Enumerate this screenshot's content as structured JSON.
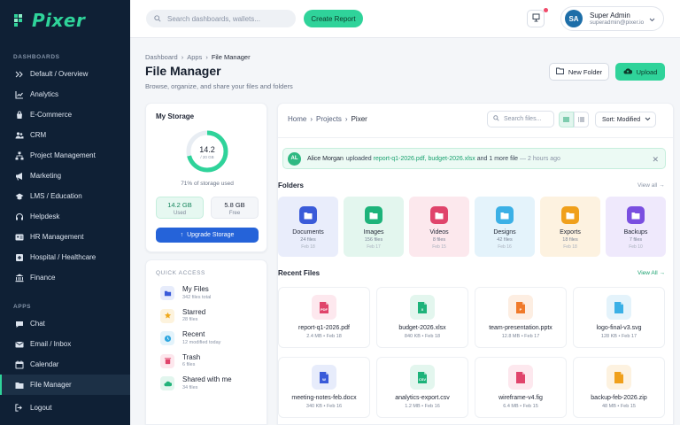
{
  "app": {
    "name": "Pixer"
  },
  "sidebar": {
    "dashboards_label": "DASHBOARDS",
    "apps_label": "APPS",
    "dashboards": [
      {
        "label": "Default / Overview",
        "icon": "double-chevron-icon"
      },
      {
        "label": "Analytics",
        "icon": "chart-line-icon"
      },
      {
        "label": "E-Commerce",
        "icon": "shopping-bag-icon"
      },
      {
        "label": "CRM",
        "icon": "users-icon"
      },
      {
        "label": "Project Management",
        "icon": "sitemap-icon"
      },
      {
        "label": "Marketing",
        "icon": "megaphone-icon"
      },
      {
        "label": "LMS / Education",
        "icon": "graduation-cap-icon"
      },
      {
        "label": "Helpdesk",
        "icon": "headset-icon"
      },
      {
        "label": "HR Management",
        "icon": "id-card-icon"
      },
      {
        "label": "Hospital / Healthcare",
        "icon": "hospital-icon"
      },
      {
        "label": "Finance",
        "icon": "bank-icon"
      }
    ],
    "apps": [
      {
        "label": "Chat",
        "icon": "chat-icon"
      },
      {
        "label": "Email / Inbox",
        "icon": "envelope-icon"
      },
      {
        "label": "Calendar",
        "icon": "calendar-icon"
      },
      {
        "label": "File Manager",
        "icon": "folder-open-icon",
        "active": true
      }
    ],
    "logout": "Logout"
  },
  "header": {
    "search_placeholder": "Search dashboards, wallets...",
    "create_report": "Create Report",
    "user": {
      "initials": "SA",
      "name": "Super Admin",
      "email": "superadmin@pixer.io"
    }
  },
  "page": {
    "breadcrumb": [
      "Dashboard",
      "Apps",
      "File Manager"
    ],
    "title": "File Manager",
    "subtitle": "Browse, organize, and share your files and folders",
    "new_folder": "New Folder",
    "upload": "Upload"
  },
  "storage": {
    "title": "My Storage",
    "used_value": "14.2",
    "total": "/ 20 GB",
    "percent": 71,
    "percent_text": "71% of storage used",
    "used": {
      "value": "14.2 GB",
      "label": "Used"
    },
    "free": {
      "value": "5.8 GB",
      "label": "Free"
    },
    "upgrade": "Upgrade Storage",
    "accent": "#2fd39a"
  },
  "quick_access": {
    "label": "QUICK ACCESS",
    "items": [
      {
        "name": "My Files",
        "sub": "342 files total",
        "icon": "folder-icon",
        "color": "#3a5bd9",
        "bg": "#e7ecfb"
      },
      {
        "name": "Starred",
        "sub": "28 files",
        "icon": "star-icon",
        "color": "#f0a91b",
        "bg": "#fdf3dd"
      },
      {
        "name": "Recent",
        "sub": "12 modified today",
        "icon": "clock-icon",
        "color": "#31a8e0",
        "bg": "#e3f3fb"
      },
      {
        "name": "Trash",
        "sub": "6 files",
        "icon": "trash-icon",
        "color": "#e0446b",
        "bg": "#fde7ed"
      },
      {
        "name": "Shared with me",
        "sub": "34 files",
        "icon": "cloud-icon",
        "color": "#22b37a",
        "bg": "#e2f6ee"
      }
    ]
  },
  "browser": {
    "path": [
      "Home",
      "Projects",
      "Pixer"
    ],
    "search_placeholder": "Search files...",
    "sort": "Sort: Modified",
    "notification": {
      "initials": "AL",
      "name": "Alice Morgan",
      "text1": "uploaded",
      "link": "report-q1-2026.pdf, budget-2026.xlsx",
      "text2": "and 1 more file",
      "time": "— 2 hours ago"
    },
    "folders_title": "Folders",
    "folders_view_all": "View all →",
    "folders": [
      {
        "name": "Documents",
        "count": "24 files",
        "date": "Feb 18",
        "color": "#3a5bd9",
        "bg": "#e9edfb"
      },
      {
        "name": "Images",
        "count": "156 files",
        "date": "Feb 17",
        "color": "#1db37a",
        "bg": "#e3f6ee"
      },
      {
        "name": "Videos",
        "count": "8 files",
        "date": "Feb 15",
        "color": "#e0446b",
        "bg": "#fce8ed"
      },
      {
        "name": "Designs",
        "count": "42 files",
        "date": "Feb 16",
        "color": "#3bb0e6",
        "bg": "#e4f3fb"
      },
      {
        "name": "Exports",
        "count": "18 files",
        "date": "Feb 18",
        "color": "#f0a01b",
        "bg": "#fdf2e0"
      },
      {
        "name": "Backups",
        "count": "7 files",
        "date": "Feb 10",
        "color": "#7a4fe0",
        "bg": "#efe9fc"
      }
    ],
    "recent_title": "Recent Files",
    "recent_view_all": "View All →",
    "files": [
      {
        "name": "report-q1-2026.pdf",
        "meta": "2.4 MB • Feb 18",
        "tag": "PDF",
        "icon": "pdf-file-icon",
        "color": "#e0446b",
        "bg": "#fde8ee"
      },
      {
        "name": "budget-2026.xlsx",
        "meta": "840 KB • Feb 18",
        "tag": "X",
        "icon": "excel-file-icon",
        "color": "#1db37a",
        "bg": "#e3f6ee"
      },
      {
        "name": "team-presentation.pptx",
        "meta": "12.8 MB • Feb 17",
        "tag": "P",
        "icon": "ppt-file-icon",
        "color": "#f07a2a",
        "bg": "#fdeee2"
      },
      {
        "name": "logo-final-v3.svg",
        "meta": "128 KB • Feb 17",
        "tag": "",
        "icon": "image-file-icon",
        "color": "#3bb0e6",
        "bg": "#e4f3fb"
      },
      {
        "name": "meeting-notes-feb.docx",
        "meta": "340 KB • Feb 16",
        "tag": "W",
        "icon": "word-file-icon",
        "color": "#3a5bd9",
        "bg": "#e7ecfb"
      },
      {
        "name": "analytics-export.csv",
        "meta": "1.2 MB • Feb 16",
        "tag": "CSV",
        "icon": "csv-file-icon",
        "color": "#1db37a",
        "bg": "#e3f6ee"
      },
      {
        "name": "wireframe-v4.fig",
        "meta": "6.4 MB • Feb 15",
        "tag": "",
        "icon": "figma-file-icon",
        "color": "#e0446b",
        "bg": "#fde8ee"
      },
      {
        "name": "backup-feb-2026.zip",
        "meta": "48 MB • Feb 15",
        "tag": "",
        "icon": "zip-file-icon",
        "color": "#f0a01b",
        "bg": "#fdf2e0"
      }
    ]
  }
}
